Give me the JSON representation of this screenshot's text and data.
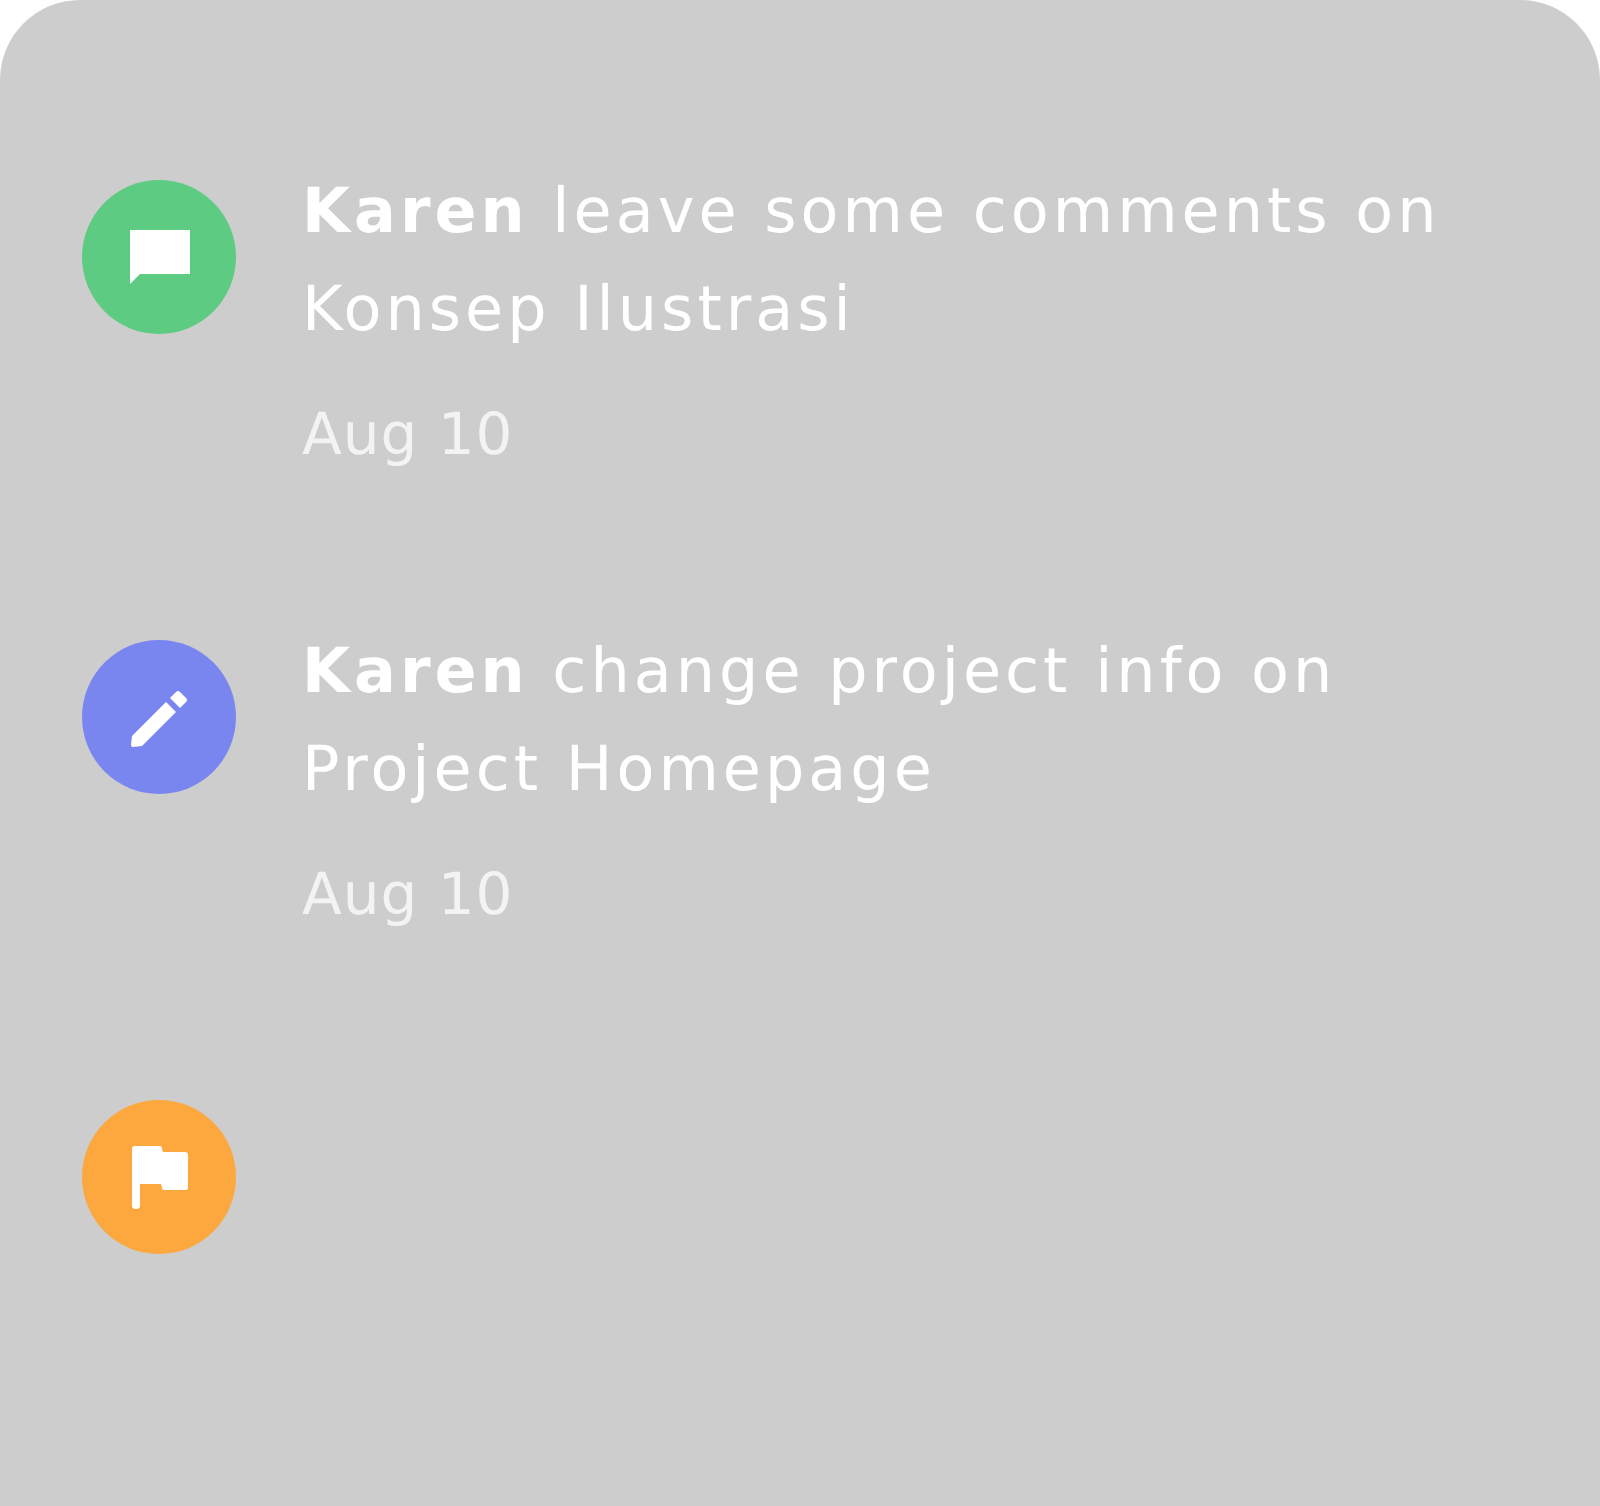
{
  "activities": [
    {
      "kind": "comment",
      "color": "#5ecb83",
      "text": "**Karen** leave some comments on Konsep Ilustrasi",
      "date": "Aug 10"
    },
    {
      "kind": "edit",
      "color": "#7a86f0",
      "text": "**Karen** change project info on Project Homepage",
      "date": "Aug 10"
    },
    {
      "kind": "flag",
      "color": "#fda73f"
    }
  ]
}
